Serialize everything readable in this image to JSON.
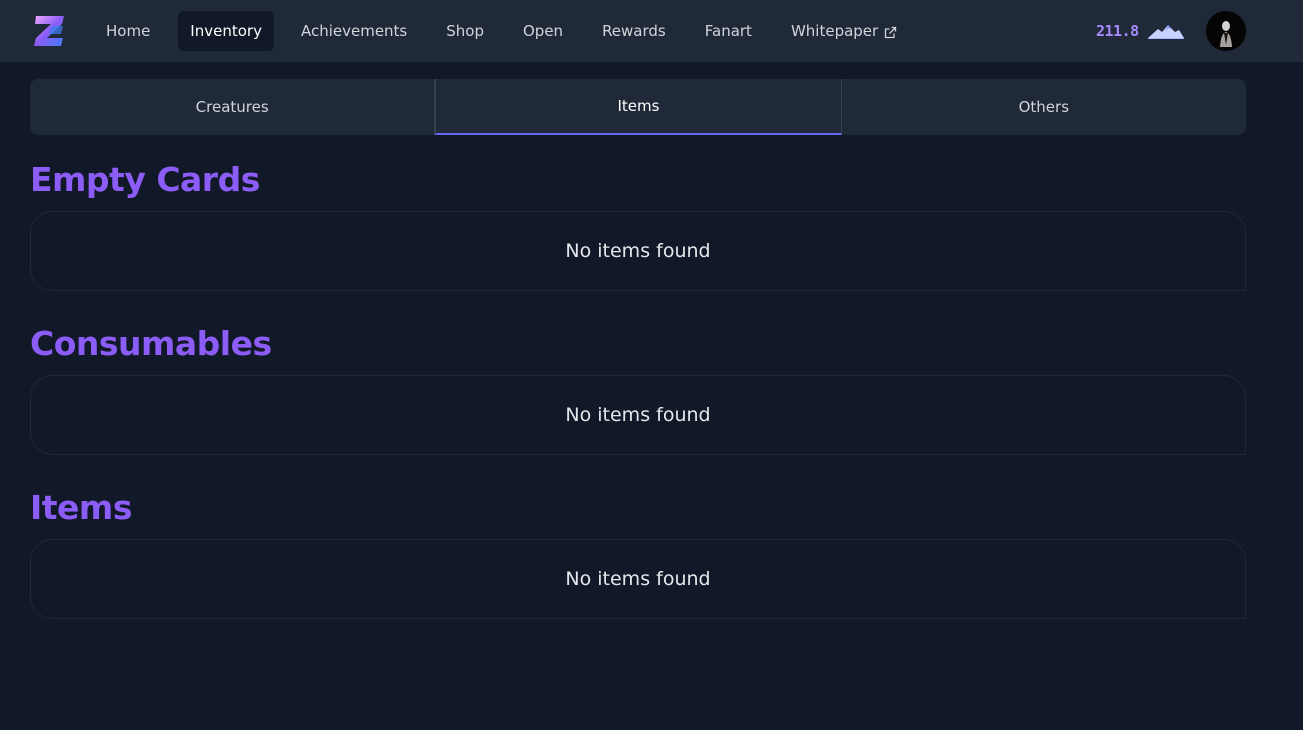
{
  "nav": {
    "logo_label": "Z",
    "items": [
      {
        "label": "Home"
      },
      {
        "label": "Inventory",
        "active": true
      },
      {
        "label": "Achievements"
      },
      {
        "label": "Shop"
      },
      {
        "label": "Open"
      },
      {
        "label": "Rewards"
      },
      {
        "label": "Fanart"
      },
      {
        "label": "Whitepaper",
        "external": true
      }
    ],
    "balance": "211.8",
    "balance_icon": "mountain-icon",
    "external_icon": "external-link-icon"
  },
  "tabs": [
    {
      "label": "Creatures"
    },
    {
      "label": "Items",
      "active": true
    },
    {
      "label": "Others"
    }
  ],
  "sections": [
    {
      "title": "Empty Cards",
      "empty_text": "No items found"
    },
    {
      "title": "Consumables",
      "empty_text": "No items found"
    },
    {
      "title": "Items",
      "empty_text": "No items found"
    }
  ],
  "colors": {
    "background": "#111827",
    "navbar": "#1f2937",
    "accent": "#8b5cf6",
    "tab_underline": "#6366f1",
    "balance": "#a78bfa"
  }
}
